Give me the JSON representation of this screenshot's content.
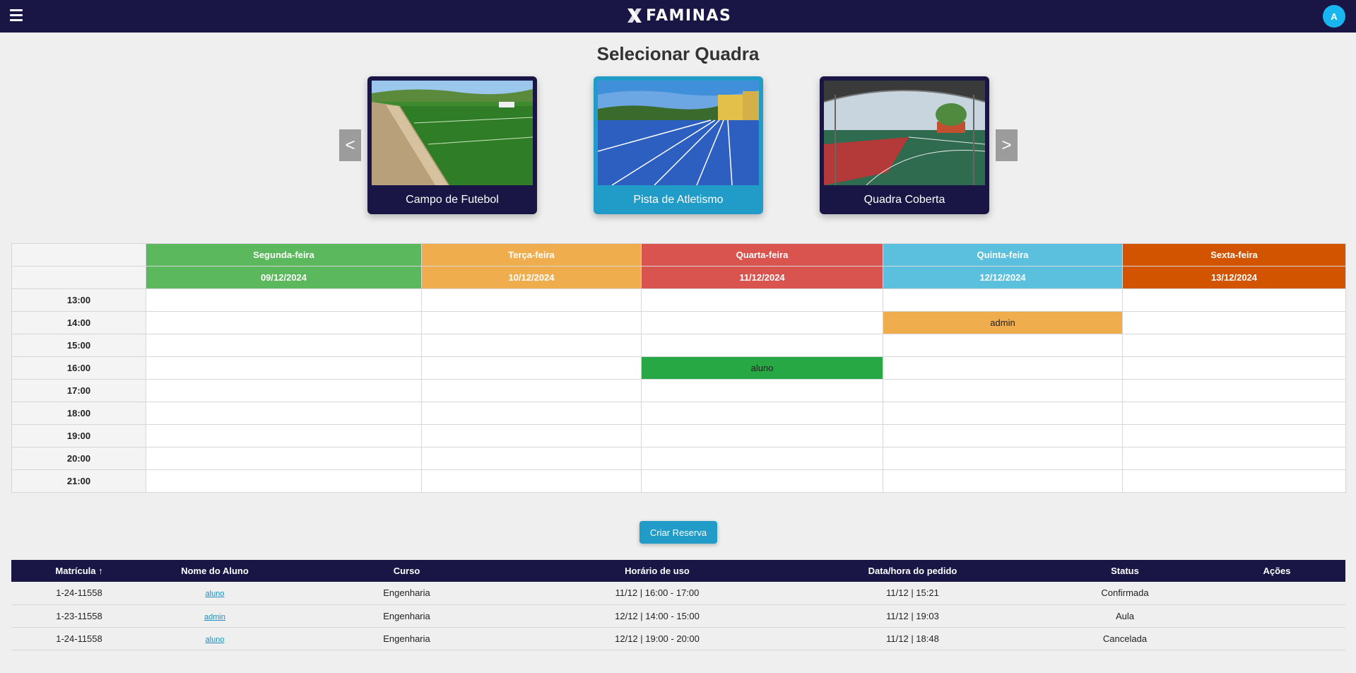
{
  "app": {
    "logo_text": "FAMINAS",
    "avatar_initial": "A",
    "colors": {
      "navbar": "#191646",
      "accent": "#219bc8",
      "avatar": "#19b5f0"
    }
  },
  "page_title": "Selecionar Quadra",
  "carousel": {
    "prev_label": "<",
    "next_label": ">",
    "courts": [
      {
        "name": "Campo de Futebol",
        "selected": false
      },
      {
        "name": "Pista de Atletismo",
        "selected": true
      },
      {
        "name": "Quadra Coberta",
        "selected": false
      }
    ]
  },
  "schedule": {
    "days": [
      {
        "name": "Segunda-feira",
        "date": "09/12/2024",
        "color": "#5cb85c"
      },
      {
        "name": "Terça-feira",
        "date": "10/12/2024",
        "color": "#f0ad4e"
      },
      {
        "name": "Quarta-feira",
        "date": "11/12/2024",
        "color": "#d9534f"
      },
      {
        "name": "Quinta-feira",
        "date": "12/12/2024",
        "color": "#5bc0de"
      },
      {
        "name": "Sexta-feira",
        "date": "13/12/2024",
        "color": "#d35400"
      }
    ],
    "times": [
      "13:00",
      "14:00",
      "15:00",
      "16:00",
      "17:00",
      "18:00",
      "19:00",
      "20:00",
      "21:00"
    ],
    "bookings": [
      {
        "day": "Quinta-feira",
        "time": "14:00",
        "user": "admin",
        "color": "#f0ad4e"
      },
      {
        "day": "Quarta-feira",
        "time": "16:00",
        "user": "aluno",
        "color": "#28a745"
      }
    ]
  },
  "create_button": "Criar Reserva",
  "reservations": {
    "headers": {
      "matricula": "Matrícula ↑",
      "nome": "Nome do Aluno",
      "curso": "Curso",
      "horario": "Horário de uso",
      "pedido": "Data/hora do pedido",
      "status": "Status",
      "acoes": "Ações"
    },
    "rows": [
      {
        "matricula": "1-24-11558",
        "nome": "aluno",
        "curso": "Engenharia",
        "horario": "11/12 | 16:00 - 17:00",
        "pedido": "11/12 | 15:21",
        "status": "Confirmada"
      },
      {
        "matricula": "1-23-11558",
        "nome": "admin",
        "curso": "Engenharia",
        "horario": "12/12 | 14:00 - 15:00",
        "pedido": "11/12 | 19:03",
        "status": "Aula"
      },
      {
        "matricula": "1-24-11558",
        "nome": "aluno",
        "curso": "Engenharia",
        "horario": "12/12 | 19:00 - 20:00",
        "pedido": "11/12 | 18:48",
        "status": "Cancelada"
      }
    ]
  }
}
